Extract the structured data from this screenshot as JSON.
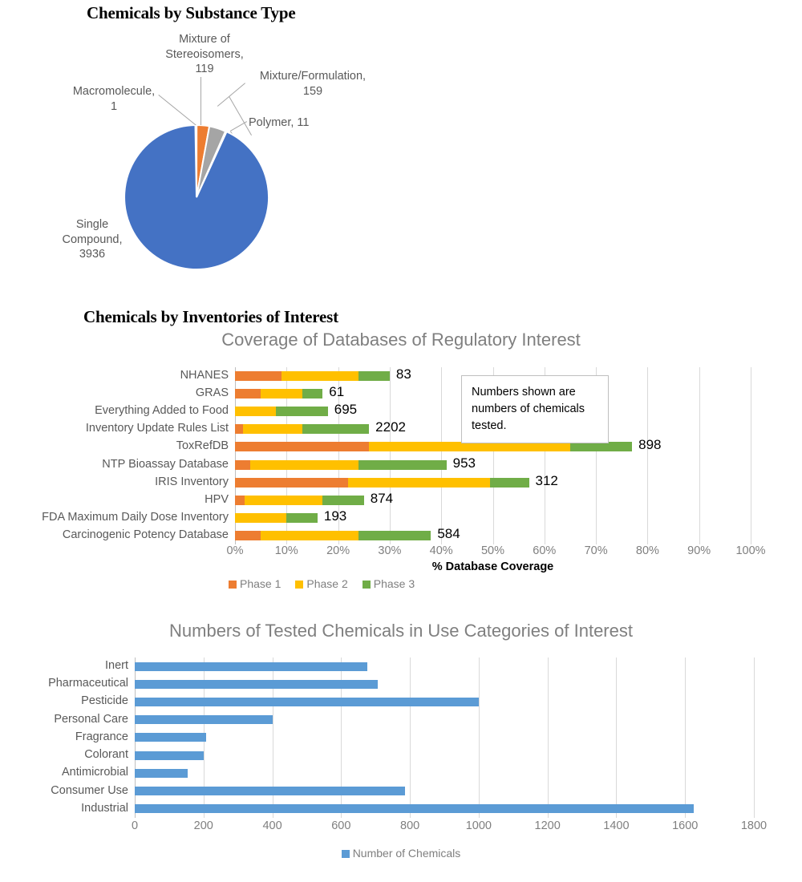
{
  "pie_section": {
    "heading": "Chemicals by Substance Type",
    "labels": [
      {
        "text": "Single\nCompound,\n3936"
      },
      {
        "text": "Macromolecule,\n1"
      },
      {
        "text": "Mixture of\nStereoisomers,\n119"
      },
      {
        "text": "Mixture/Formulation,\n159"
      },
      {
        "text": "Polymer, 11"
      }
    ]
  },
  "inventories_section": {
    "heading": "Chemicals by Inventories of Interest",
    "callout": "Numbers shown are numbers of chemicals tested.",
    "xaxis_title": "% Database Coverage",
    "xticks": [
      "0%",
      "10%",
      "20%",
      "30%",
      "40%",
      "50%",
      "60%",
      "70%",
      "80%",
      "90%",
      "100%"
    ],
    "legend": [
      "Phase 1",
      "Phase 2",
      "Phase 3"
    ]
  },
  "use_section": {
    "xticks": [
      "0",
      "200",
      "400",
      "600",
      "800",
      "1000",
      "1200",
      "1400",
      "1600",
      "1800"
    ],
    "legend": [
      "Number of Chemicals"
    ]
  },
  "colors": {
    "blue": "#4472C4",
    "orange": "#ED7D31",
    "gray": "#A5A5A5",
    "yellow": "#FFC000",
    "green": "#70AD47",
    "light_blue": "#5B9BD5",
    "gridline": "#D9D9D9",
    "label_gray": "#595959",
    "title_gray": "#7F7F7F"
  },
  "chart_data": [
    {
      "type": "pie",
      "title": "Chemicals by Substance Type",
      "labels": [
        "Single Compound",
        "Macromolecule",
        "Mixture of Stereoisomers",
        "Mixture/Formulation",
        "Polymer"
      ],
      "values": [
        3936,
        1,
        119,
        159,
        11
      ],
      "colors": [
        "#4472C4",
        "#ED7D31",
        "#ED7D31",
        "#A5A5A5",
        "#A5A5A5"
      ],
      "legend": "none",
      "data_labels": "category name, value"
    },
    {
      "type": "bar",
      "orientation": "horizontal",
      "stacked": true,
      "title": "Coverage of Databases of Regulatory Interest",
      "xlabel": "% Database Coverage",
      "ylabel": "",
      "xlim": [
        0,
        100
      ],
      "xtick_values": [
        0,
        10,
        20,
        30,
        40,
        50,
        60,
        70,
        80,
        90,
        100
      ],
      "grid": "vertical",
      "legend": "bottom",
      "categories": [
        "NHANES",
        "GRAS",
        "Everything Added to Food",
        "Inventory Update Rules List",
        "ToxRefDB",
        "NTP Bioassay Database",
        "IRIS Inventory",
        "HPV",
        "FDA Maximum Daily Dose Inventory",
        "Carcinogenic Potency Database"
      ],
      "series": [
        {
          "name": "Phase 1",
          "color": "#ED7D31",
          "values": [
            9.0,
            5.0,
            0.0,
            1.5,
            26.0,
            3.0,
            22.0,
            1.8,
            0.0,
            5.0
          ]
        },
        {
          "name": "Phase 2",
          "color": "#FFC000",
          "values": [
            15.0,
            8.0,
            8.0,
            11.5,
            39.0,
            21.0,
            27.5,
            15.2,
            10.0,
            19.0
          ]
        },
        {
          "name": "Phase 3",
          "color": "#70AD47",
          "values": [
            6.0,
            4.0,
            10.0,
            13.0,
            12.0,
            17.0,
            7.5,
            8.0,
            6.0,
            14.0
          ]
        }
      ],
      "point_labels": [
        83,
        61,
        695,
        2202,
        898,
        953,
        312,
        874,
        193,
        584
      ],
      "annotation": "Numbers shown are numbers of chemicals tested."
    },
    {
      "type": "bar",
      "orientation": "horizontal",
      "title": "Numbers of Tested Chemicals in Use Categories of Interest",
      "xlabel": "",
      "ylabel": "",
      "xlim": [
        0,
        1800
      ],
      "xtick_values": [
        0,
        200,
        400,
        600,
        800,
        1000,
        1200,
        1400,
        1600,
        1800
      ],
      "grid": "vertical",
      "legend": "bottom",
      "series_name": "Number of Chemicals",
      "color": "#5B9BD5",
      "categories": [
        "Inert",
        "Pharmaceutical",
        "Pesticide",
        "Personal Care",
        "Fragrance",
        "Colorant",
        "Antimicrobial",
        "Consumer Use",
        "Industrial"
      ],
      "values": [
        677,
        707,
        1001,
        400,
        207,
        200,
        154,
        786,
        1625
      ]
    }
  ]
}
